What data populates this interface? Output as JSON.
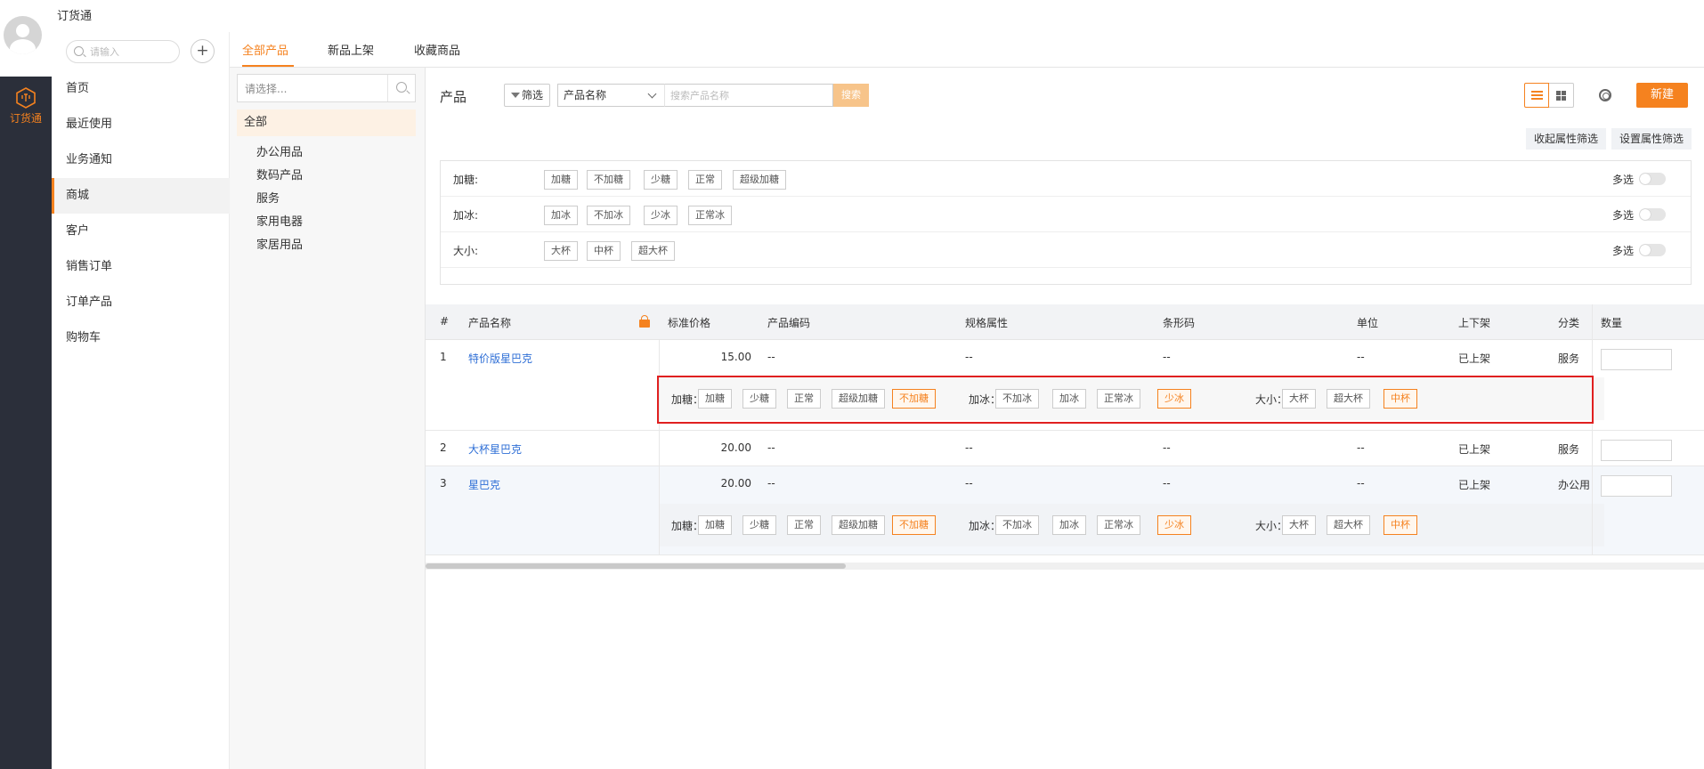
{
  "app": {
    "title": "订货通",
    "rail_label": "订货通"
  },
  "colors": {
    "accent": "#f5821f",
    "rail": "#2b2f3a",
    "link": "#2f6fd6",
    "highlight": "#e02020"
  },
  "nav": {
    "search_placeholder": "请输入",
    "items": [
      "首页",
      "最近使用",
      "业务通知",
      "商城",
      "客户",
      "销售订单",
      "订单产品",
      "购物车"
    ],
    "active": "商城"
  },
  "tabs": [
    "全部产品",
    "新品上架",
    "收藏商品"
  ],
  "categories": {
    "search_placeholder": "请选择...",
    "all": "全部",
    "items": [
      "办公用品",
      "数码产品",
      "服务",
      "家用电器",
      "家居用品"
    ]
  },
  "toolbar": {
    "title": "产品",
    "filter_label": "筛选",
    "field_select": "产品名称",
    "search_placeholder": "搜索产品名称",
    "search_button": "搜索",
    "new_button": "新建",
    "collapse_button": "收起属性筛选",
    "set_button": "设置属性筛选"
  },
  "attr_filters": [
    {
      "label": "加糖:",
      "options": [
        "加糖",
        "不加糖",
        "少糖",
        "正常",
        "超级加糖"
      ],
      "multi": "多选"
    },
    {
      "label": "加冰:",
      "options": [
        "加冰",
        "不加冰",
        "少冰",
        "正常冰"
      ],
      "multi": "多选"
    },
    {
      "label": "大小:",
      "options": [
        "大杯",
        "中杯",
        "超大杯"
      ],
      "multi": "多选"
    }
  ],
  "table": {
    "columns": [
      "#",
      "产品名称",
      "标准价格",
      "产品编码",
      "规格属性",
      "条形码",
      "单位",
      "上下架",
      "分类",
      "数量"
    ],
    "rows": [
      {
        "index": "1",
        "name": "特价版星巴克",
        "price": "15.00",
        "code": "--",
        "spec": "--",
        "barcode": "--",
        "unit": "--",
        "status": "已上架",
        "category": "服务"
      },
      {
        "index": "2",
        "name": "大杯星巴克",
        "price": "20.00",
        "code": "--",
        "spec": "--",
        "barcode": "--",
        "unit": "--",
        "status": "已上架",
        "category": "服务"
      },
      {
        "index": "3",
        "name": "星巴克",
        "price": "20.00",
        "code": "--",
        "spec": "--",
        "barcode": "--",
        "unit": "--",
        "status": "已上架",
        "category": "办公用"
      }
    ],
    "spec_strip": {
      "sugar": {
        "label": "加糖：",
        "options": [
          "加糖",
          "少糖",
          "正常",
          "超级加糖",
          "不加糖"
        ],
        "selected": "不加糖"
      },
      "ice": {
        "label": "加冰：",
        "options": [
          "不加冰",
          "加冰",
          "正常冰",
          "少冰"
        ],
        "selected": "少冰"
      },
      "size": {
        "label": "大小：",
        "options": [
          "大杯",
          "超大杯",
          "中杯"
        ],
        "selected": "中杯"
      }
    }
  }
}
